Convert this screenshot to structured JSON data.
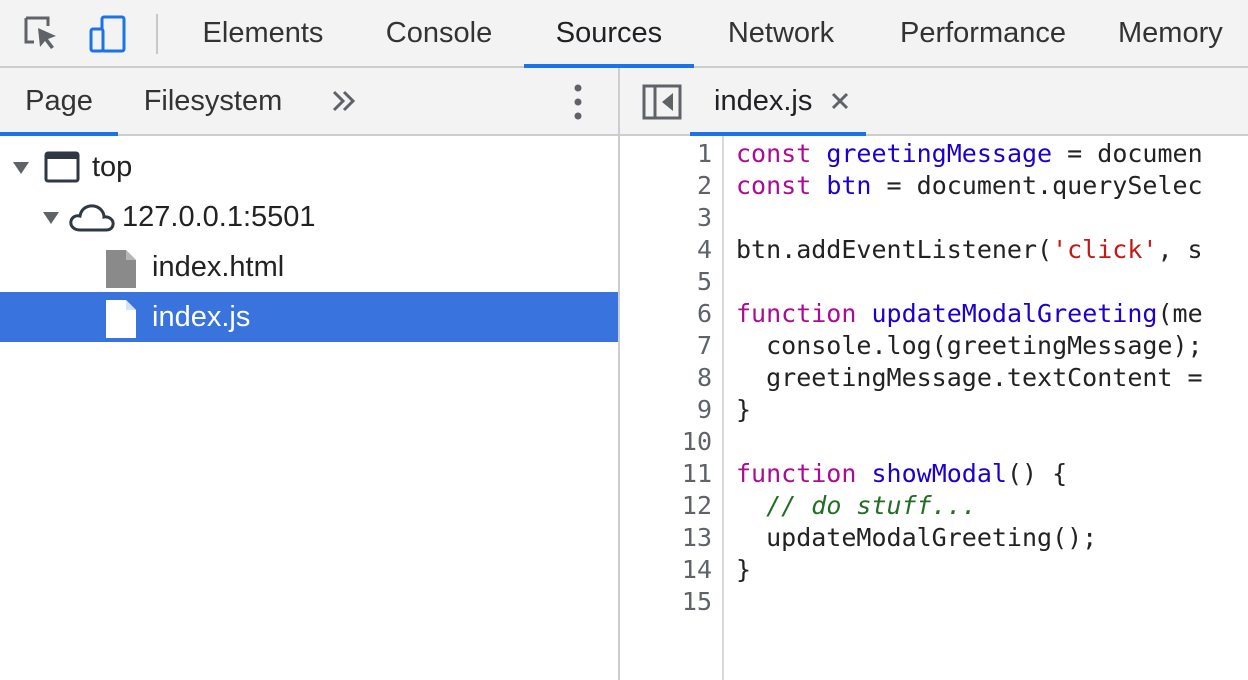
{
  "toolbar": {
    "icons": [
      "inspect-element-icon",
      "device-toggle-icon"
    ],
    "tabs": [
      "Elements",
      "Console",
      "Sources",
      "Network",
      "Performance",
      "Memory"
    ],
    "active_tab": "Sources"
  },
  "navigator": {
    "tabs": [
      "Page",
      "Filesystem"
    ],
    "active_tab": "Page",
    "more_icon": "double-chevron-right-icon",
    "menu_icon": "kebab-menu-icon",
    "tree": [
      {
        "label": "top",
        "icon": "frame-icon",
        "expanded": true
      },
      {
        "label": "127.0.0.1:5501",
        "icon": "cloud-icon",
        "expanded": true
      },
      {
        "label": "index.html",
        "icon": "file-html-icon"
      },
      {
        "label": "index.js",
        "icon": "file-js-icon",
        "selected": true
      }
    ]
  },
  "editor": {
    "toggle_icon": "toggle-navigator-icon",
    "open_file": {
      "name": "index.js",
      "close_icon": "close-icon"
    },
    "line_numbers": [
      "1",
      "2",
      "3",
      "4",
      "5",
      "6",
      "7",
      "8",
      "9",
      "10",
      "11",
      "12",
      "13",
      "14",
      "15"
    ],
    "lines": [
      [
        {
          "t": "const",
          "c": "kw"
        },
        {
          "t": " "
        },
        {
          "t": "greetingMessage",
          "c": "def"
        },
        {
          "t": " = documen"
        }
      ],
      [
        {
          "t": "const",
          "c": "kw"
        },
        {
          "t": " "
        },
        {
          "t": "btn",
          "c": "def"
        },
        {
          "t": " = document.querySelec"
        }
      ],
      [],
      [
        {
          "t": "btn.addEventListener("
        },
        {
          "t": "'click'",
          "c": "str"
        },
        {
          "t": ", s"
        }
      ],
      [],
      [
        {
          "t": "function",
          "c": "kw"
        },
        {
          "t": " "
        },
        {
          "t": "updateModalGreeting",
          "c": "def"
        },
        {
          "t": "(me"
        }
      ],
      [
        {
          "t": "  console.log(greetingMessage);"
        }
      ],
      [
        {
          "t": "  greetingMessage.textContent ="
        }
      ],
      [
        {
          "t": "}"
        }
      ],
      [],
      [
        {
          "t": "function",
          "c": "kw"
        },
        {
          "t": " "
        },
        {
          "t": "showModal",
          "c": "def"
        },
        {
          "t": "() {"
        }
      ],
      [
        {
          "t": "  "
        },
        {
          "t": "// do stuff...",
          "c": "com"
        }
      ],
      [
        {
          "t": "  updateModalGreeting();"
        }
      ],
      [
        {
          "t": "}"
        }
      ],
      []
    ]
  },
  "colors": {
    "accent": "#1a73e8",
    "selection": "#3873de",
    "toolbar_bg": "#f3f3f3"
  }
}
